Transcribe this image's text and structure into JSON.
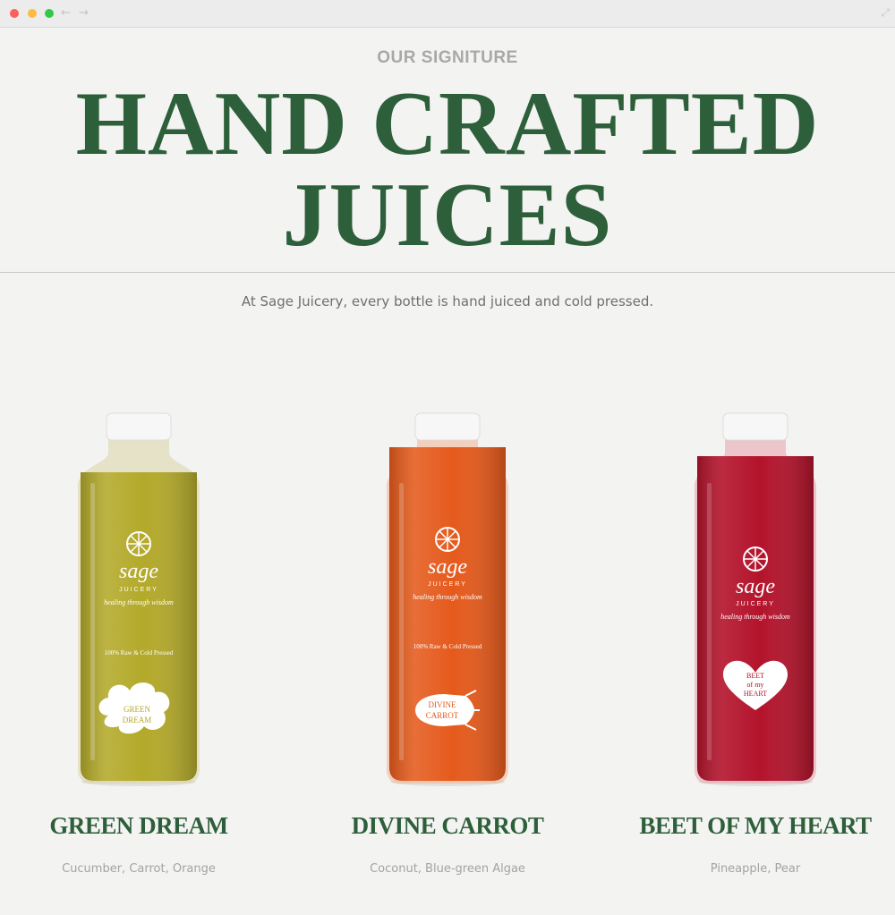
{
  "hero": {
    "eyebrow": "OUR SIGNITURE",
    "headline_line1": "HAND CRAFTED",
    "headline_line2": "JUICES",
    "intro": "At Sage Juicery, every bottle is hand juiced and cold pressed."
  },
  "products": [
    {
      "name": "GREEN DREAM",
      "ingredients": "Cucumber, Carrot, Orange",
      "label_brand": "sage",
      "label_sub": "JUICERY",
      "label_tagline": "healing through wisdom",
      "label_claim": "100% Raw & Cold Pressed",
      "sticker_line1": "GREEN",
      "sticker_line2": "DREAM",
      "liquid_color": "#b3a92a"
    },
    {
      "name": "DIVINE CARROT",
      "ingredients": "Coconut, Blue-green Algae",
      "label_brand": "sage",
      "label_sub": "JUICERY",
      "label_tagline": "healing through wisdom",
      "label_claim": "100% Raw & Cold Pressed",
      "sticker_line1": "DIVINE",
      "sticker_line2": "CARROT",
      "liquid_color": "#e55a1c"
    },
    {
      "name": "BEET OF MY HEART",
      "ingredients": "Pineapple, Pear",
      "label_brand": "sage",
      "label_sub": "JUICERY",
      "label_tagline": "healing through wisdom",
      "sticker_line1": "BEET",
      "sticker_line2": "of my",
      "sticker_line3": "HEART",
      "liquid_color": "#b3132b"
    }
  ],
  "colors": {
    "accent_green": "#2e5f3b",
    "background": "#f3f3f2"
  }
}
